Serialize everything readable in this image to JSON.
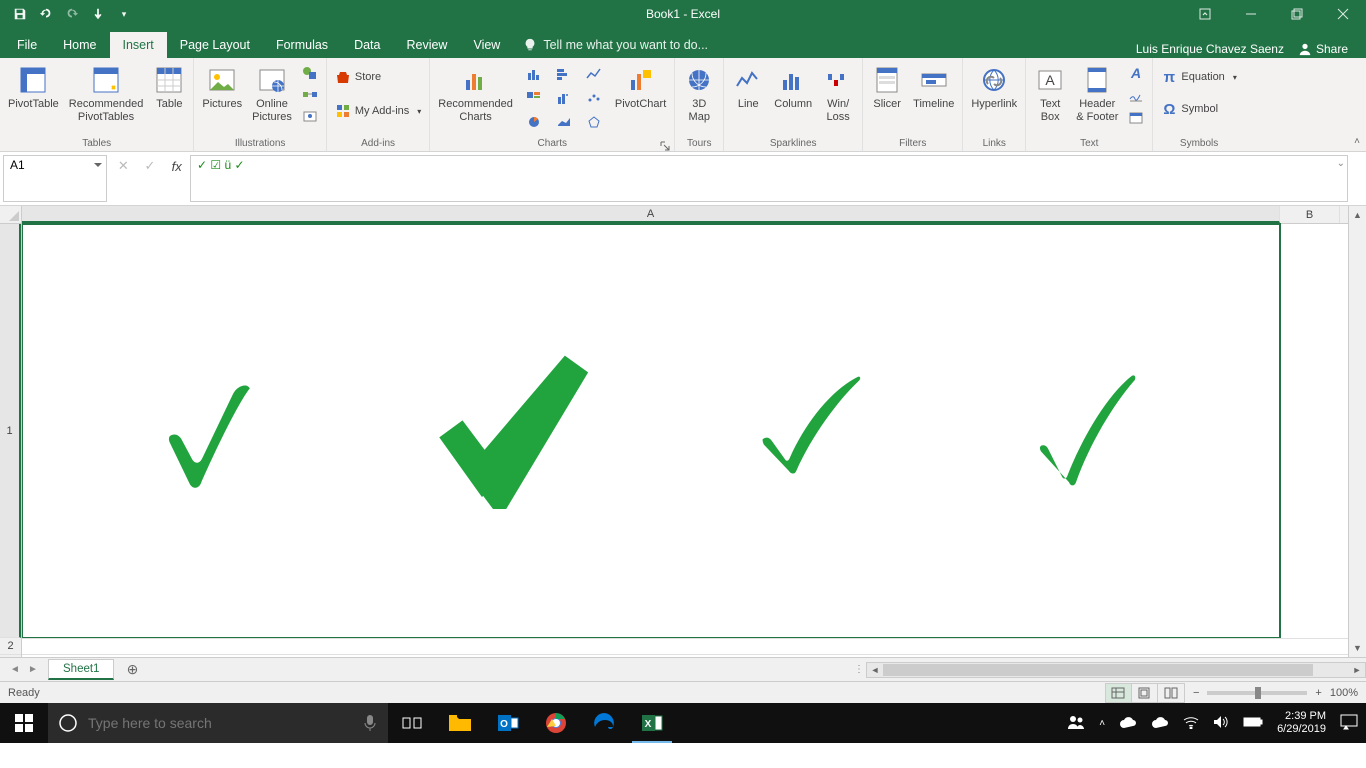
{
  "title": "Book1 - Excel",
  "user": "Luis Enrique Chavez Saenz",
  "share_label": "Share",
  "tabs": {
    "file": "File",
    "home": "Home",
    "insert": "Insert",
    "pagelayout": "Page Layout",
    "formulas": "Formulas",
    "data": "Data",
    "review": "Review",
    "view": "View"
  },
  "tellme_placeholder": "Tell me what you want to do...",
  "ribbon": {
    "tables": {
      "pivottable": "PivotTable",
      "recommended": "Recommended\nPivotTables",
      "table": "Table",
      "group": "Tables"
    },
    "illustrations": {
      "pictures": "Pictures",
      "online": "Online\nPictures",
      "group": "Illustrations"
    },
    "addins": {
      "store": "Store",
      "myaddins": "My Add-ins",
      "group": "Add-ins"
    },
    "charts": {
      "recommended": "Recommended\nCharts",
      "pivotchart": "PivotChart",
      "group": "Charts"
    },
    "tours": {
      "map": "3D\nMap",
      "group": "Tours"
    },
    "sparklines": {
      "line": "Line",
      "column": "Column",
      "winloss": "Win/\nLoss",
      "group": "Sparklines"
    },
    "filters": {
      "slicer": "Slicer",
      "timeline": "Timeline",
      "group": "Filters"
    },
    "links": {
      "hyperlink": "Hyperlink",
      "group": "Links"
    },
    "text": {
      "textbox": "Text\nBox",
      "headerfooter": "Header\n& Footer",
      "group": "Text"
    },
    "symbols": {
      "equation": "Equation",
      "symbol": "Symbol",
      "group": "Symbols"
    }
  },
  "namebox": "A1",
  "formula": "✓ ☑ ü ✓",
  "columns": {
    "A": "A",
    "B": "B"
  },
  "rows": {
    "1": "1",
    "2": "2"
  },
  "sheet": "Sheet1",
  "status": "Ready",
  "zoom": "100%",
  "taskbar": {
    "search_placeholder": "Type here to search",
    "time": "2:39 PM",
    "date": "6/29/2019"
  }
}
